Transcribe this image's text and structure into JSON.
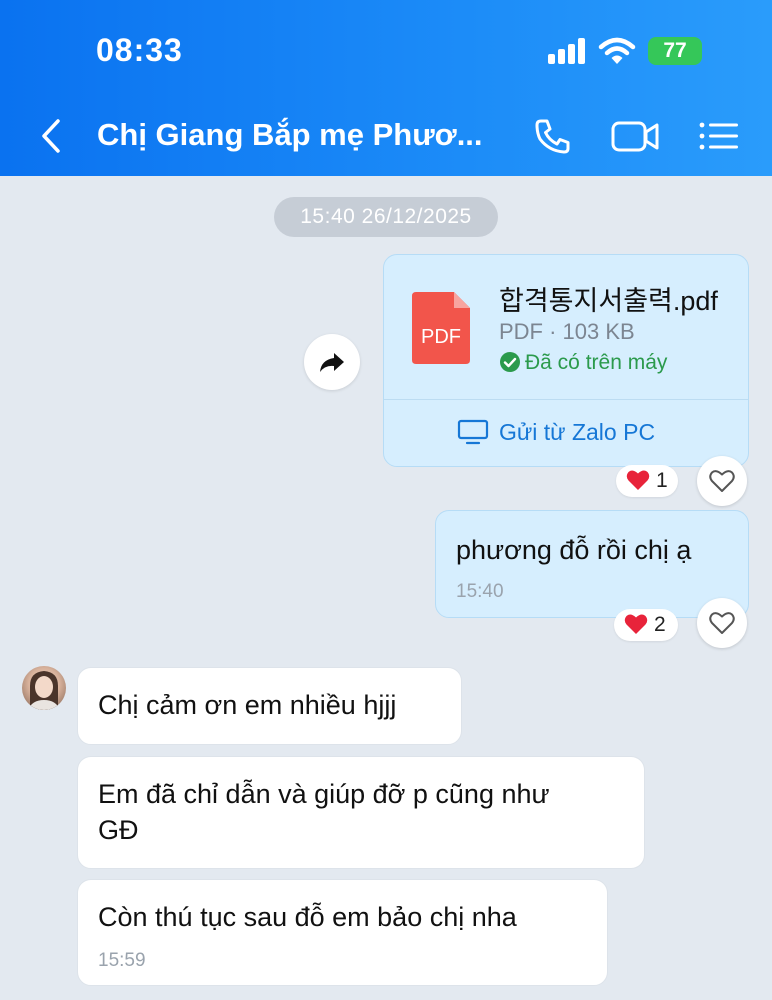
{
  "status_bar": {
    "time": "08:33",
    "battery": "77"
  },
  "header": {
    "contact_name": "Chị Giang Bắp mẹ Phươ..."
  },
  "chat": {
    "date_chip": "15:40 26/12/2025",
    "file_message": {
      "file_name": "합격통지서출력.pdf",
      "meta": "PDF · 103 KB",
      "status": "Đã có trên máy",
      "send_from": "Gửi từ Zalo PC",
      "icon_label": "PDF",
      "reaction_count": "1"
    },
    "outgoing_message": {
      "text": "phương đỗ rồi chị ạ",
      "time": "15:40",
      "reaction_count": "2"
    },
    "incoming_messages": [
      {
        "text": "Chị cảm ơn em nhiều hjjj"
      },
      {
        "text_line1": "Em đã chỉ dẫn và giúp đỡ p cũng như",
        "text_line2": "GĐ"
      },
      {
        "text": "Còn thú tục sau đỗ em bảo chị nha",
        "time": "15:59"
      }
    ]
  },
  "colors": {
    "header_start": "#0a72f0",
    "header_end": "#2a9cfb",
    "background": "#e3e9f0",
    "outgoing_bubble": "#d6eefe",
    "link_blue": "#1677d6",
    "success_green": "#2b9a4c",
    "pdf_red": "#f2554b"
  },
  "icons": [
    "back-arrow-icon",
    "phone-icon",
    "video-call-icon",
    "menu-list-icon",
    "forward-icon",
    "pdf-file-icon",
    "check-circle-icon",
    "monitor-icon",
    "heart-icon",
    "heart-outline-icon"
  ]
}
